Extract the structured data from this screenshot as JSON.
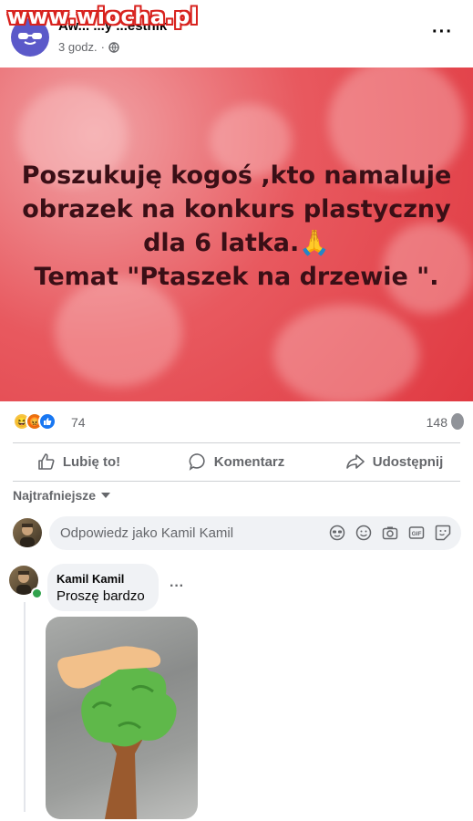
{
  "watermark": "www.wiocha.pl",
  "post": {
    "author": "Aw... ...y ...estnik",
    "time": "3 godz.",
    "meta_separator": "·",
    "more_label": "···",
    "image_text": [
      "Poszukuję kogoś ,kto namaluje",
      "obrazek na konkurs plastyczny",
      "dla 6 latka.🙏",
      "Temat \"Ptaszek na drzewie \"."
    ],
    "image_colors": {
      "base": "#e03a42",
      "text": "#3a0f16"
    }
  },
  "reactions": {
    "icons": [
      "haha-icon",
      "angry-icon",
      "like-icon"
    ],
    "count": "74",
    "shares": "148"
  },
  "actions": {
    "like": "Lubię to!",
    "comment": "Komentarz",
    "share": "Udostępnij"
  },
  "comments_sort": "Najtrafniejsze",
  "composer": {
    "placeholder": "Odpowiedz jako Kamil Kamil",
    "icons": [
      "avatar-sticker-icon",
      "emoji-icon",
      "camera-icon",
      "gif-icon",
      "sticker-icon"
    ],
    "gif_label": "GIF"
  },
  "comment": {
    "author": "Kamil Kamil",
    "text": "Proszę bardzo",
    "more_label": "···"
  },
  "colors": {
    "accent": "#1877f2",
    "secondary_text": "#65676b",
    "online": "#31a24c"
  }
}
